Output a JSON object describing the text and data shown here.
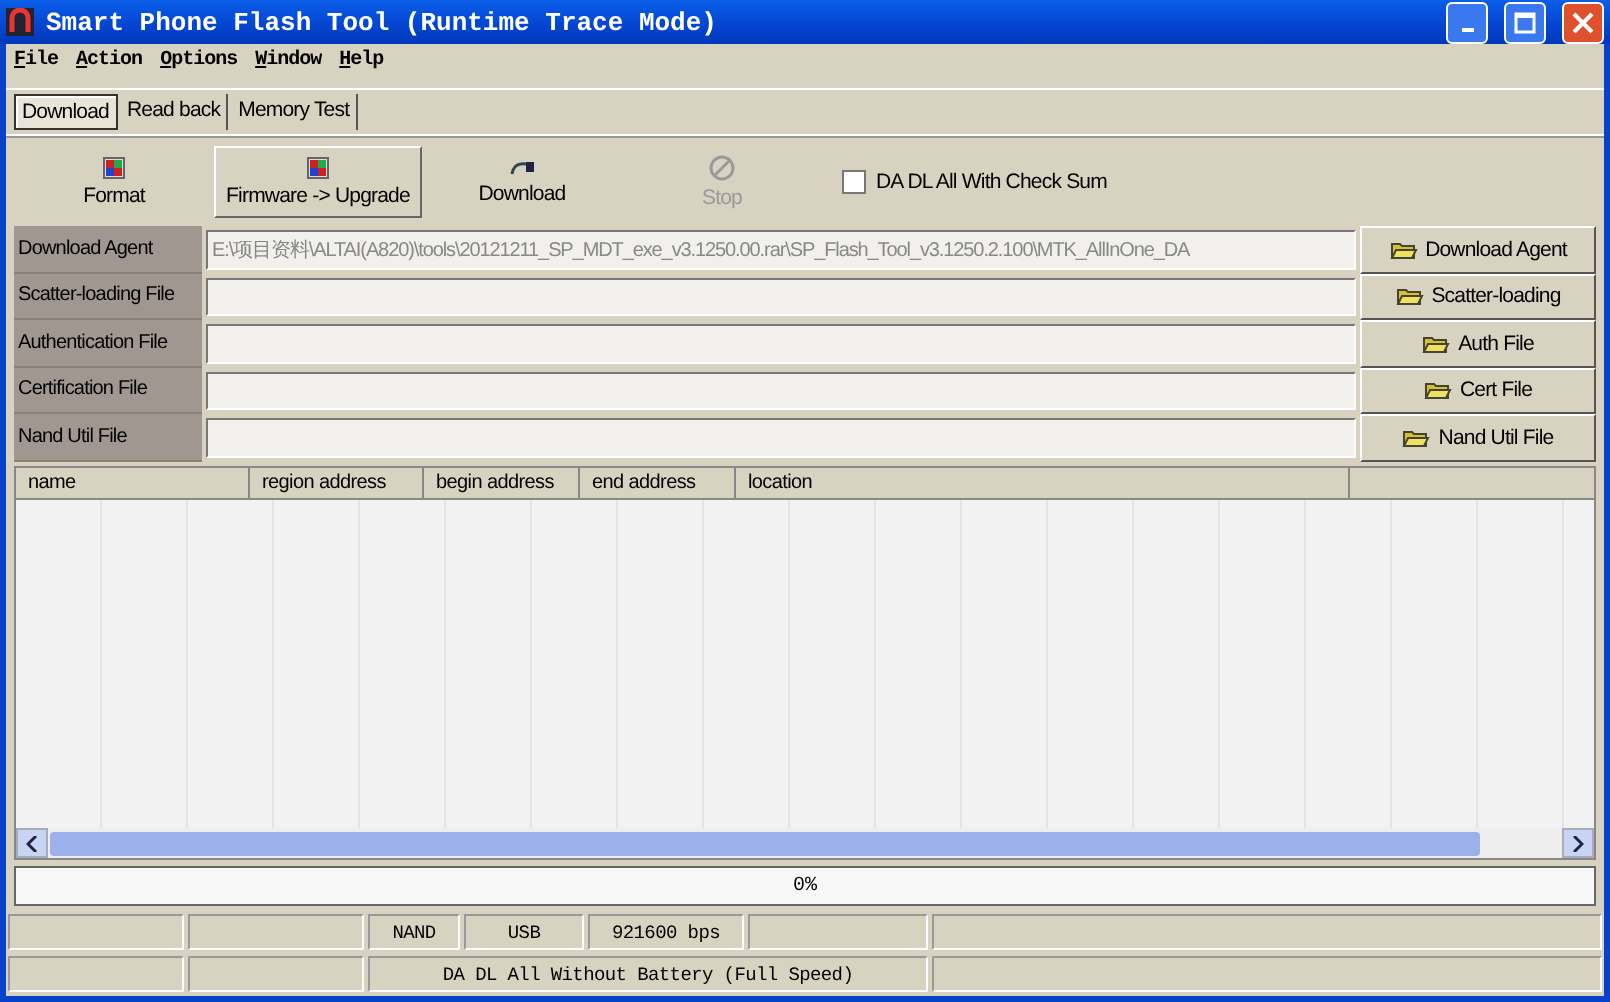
{
  "window": {
    "title": "Smart Phone Flash Tool (Runtime Trace Mode)"
  },
  "menu": [
    "File",
    "Action",
    "Options",
    "Window",
    "Help"
  ],
  "tabs": [
    {
      "label": "Download",
      "selected": true
    },
    {
      "label": "Read back",
      "selected": false
    },
    {
      "label": "Memory Test",
      "selected": false
    }
  ],
  "toolbar": [
    {
      "label": "Format",
      "kind": "cube",
      "disabled": false,
      "raised": false
    },
    {
      "label": "Firmware -> Upgrade",
      "kind": "cube",
      "disabled": false,
      "raised": true
    },
    {
      "label": "Download",
      "kind": "arrow",
      "disabled": false,
      "raised": false
    },
    {
      "label": "Stop",
      "kind": "stop",
      "disabled": true,
      "raised": false
    }
  ],
  "checksum": {
    "label": "DA DL All With Check Sum",
    "checked": false
  },
  "files": [
    {
      "label": "Download Agent",
      "value": "E:\\项目资料\\ALTAI(A820)\\tools\\20121211_SP_MDT_exe_v3.1250.00.rar\\SP_Flash_Tool_v3.1250.2.100\\MTK_AllInOne_DA",
      "button": "Download Agent"
    },
    {
      "label": "Scatter-loading File",
      "button": "Scatter-loading"
    },
    {
      "label": "Authentication File",
      "button": "Auth File"
    },
    {
      "label": "Certification File",
      "button": "Cert File"
    },
    {
      "label": "Nand Util File",
      "button": "Nand Util File"
    }
  ],
  "table": {
    "columns": [
      "name",
      "region address",
      "begin address",
      "end address",
      "location"
    ]
  },
  "progress": {
    "label": "0%",
    "level": 0
  },
  "status_bar": {
    "row_1": [
      "NAND",
      "USB",
      "921600 bps"
    ],
    "row_2": [
      "DA DL All Without Battery (Full Speed)"
    ]
  }
}
